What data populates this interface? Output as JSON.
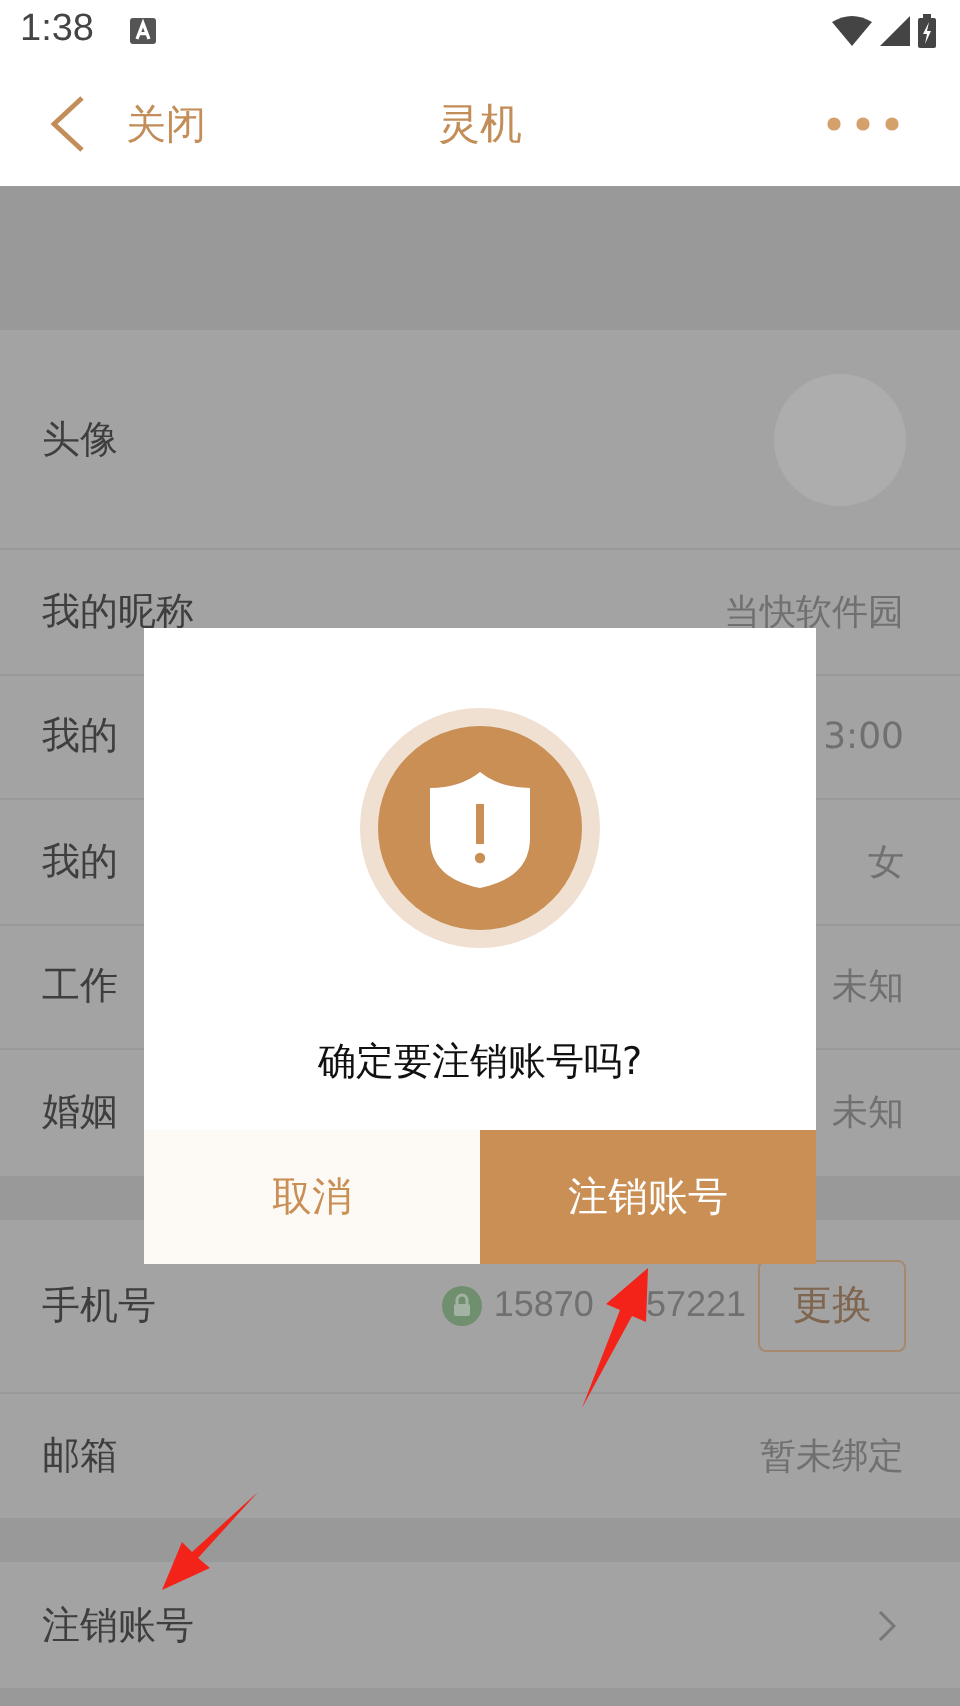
{
  "status_bar": {
    "time": "1:38"
  },
  "header": {
    "back_label": "关闭",
    "title": "灵机"
  },
  "sections": [
    {
      "rows": [
        {
          "kind": "avatar",
          "label": "头像"
        },
        {
          "kind": "value",
          "label": "我的昵称",
          "value": "当快软件园"
        },
        {
          "kind": "value",
          "label": "我的",
          "value": "3:00"
        },
        {
          "kind": "value",
          "label": "我的",
          "value": "女"
        },
        {
          "kind": "value",
          "label": "工作",
          "value": "未知"
        },
        {
          "kind": "value",
          "label": "婚姻",
          "value": "未知"
        }
      ]
    },
    {
      "rows": [
        {
          "kind": "phone",
          "label": "手机号",
          "value_parts": [
            "15870",
            "57221"
          ],
          "action": "更换"
        },
        {
          "kind": "value",
          "label": "邮箱",
          "value": "暂未绑定"
        }
      ]
    },
    {
      "rows": [
        {
          "kind": "link",
          "label": "注销账号"
        }
      ]
    }
  ],
  "dialog": {
    "message": "确定要注销账号吗?",
    "buttons": [
      {
        "kind": "cancel",
        "label": "取消"
      },
      {
        "kind": "confirm",
        "label": "注销账号"
      }
    ]
  }
}
